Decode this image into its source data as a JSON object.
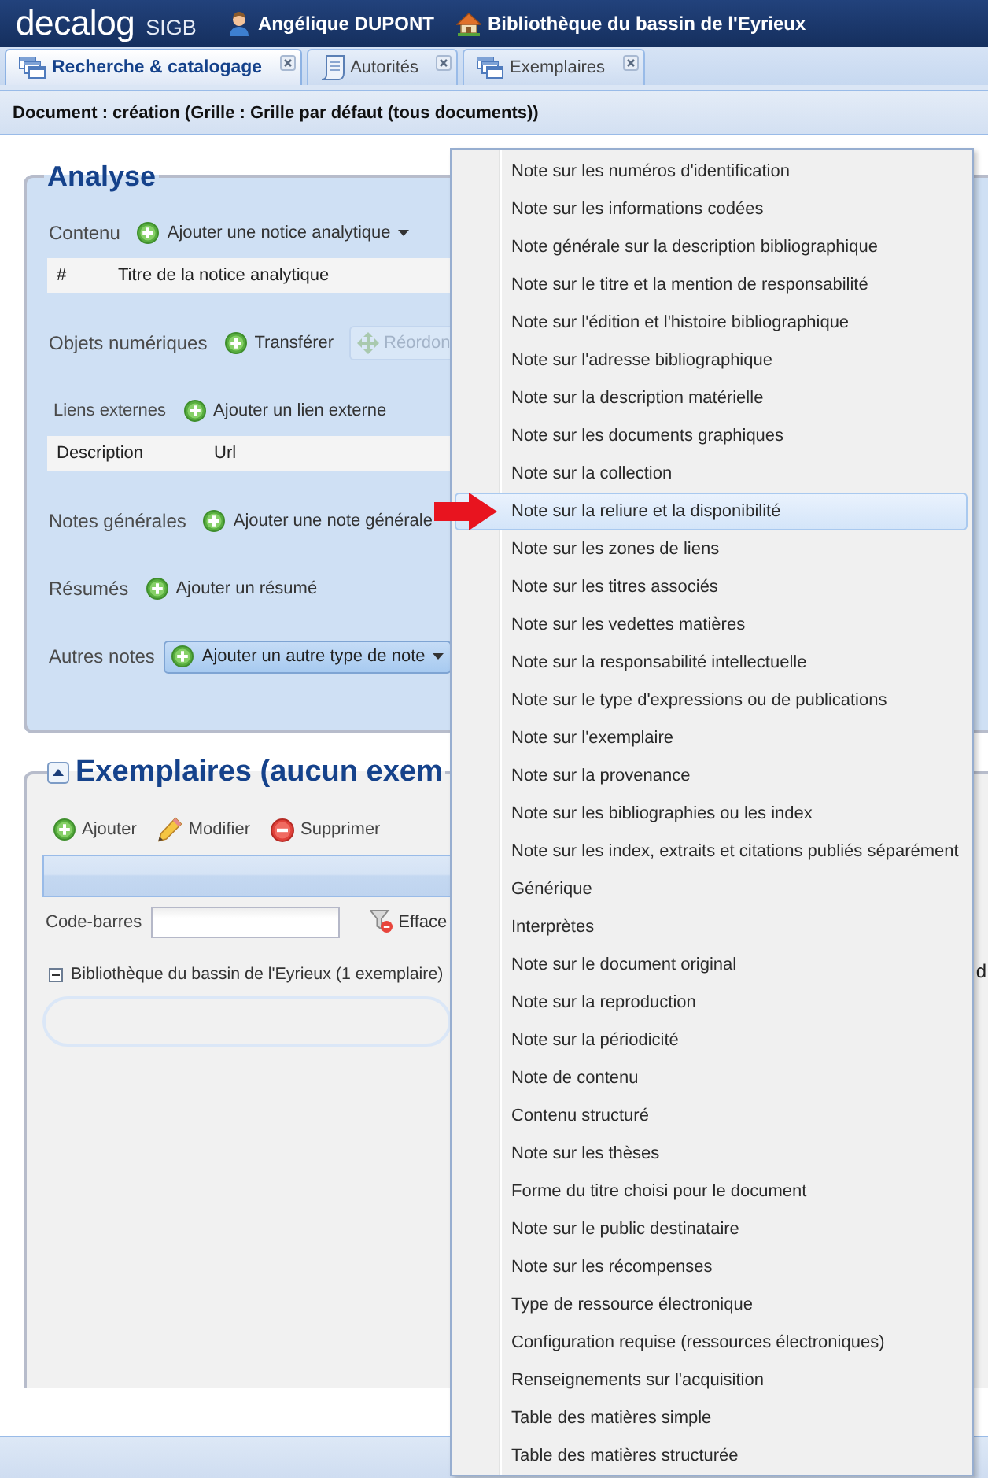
{
  "header": {
    "logo": "decalog",
    "logo_suffix": "SIGB",
    "user": "Angélique DUPONT",
    "library": "Bibliothèque du bassin de l'Eyrieux"
  },
  "tabs": [
    {
      "label": "Recherche & catalogage",
      "kind": "list",
      "selected": true
    },
    {
      "label": "Autorités",
      "kind": "document",
      "selected": false
    },
    {
      "label": "Exemplaires",
      "kind": "list",
      "selected": false
    }
  ],
  "page_title": "Document : création (Grille : Grille par défaut (tous documents))",
  "analyse": {
    "title": "Analyse",
    "sections": [
      {
        "label": "Contenu",
        "actions": [
          {
            "label": "Ajouter une notice analytique",
            "kind": "add",
            "has_menu": true,
            "disabled": false,
            "expanded": false
          }
        ],
        "columns": [
          "#",
          "Titre de la notice analytique"
        ]
      },
      {
        "label": "Objets numériques",
        "actions": [
          {
            "label": "Transférer",
            "kind": "add",
            "has_menu": false,
            "disabled": false,
            "expanded": false
          },
          {
            "label": "Réordon",
            "kind": "move",
            "has_menu": false,
            "disabled": true,
            "expanded": false
          }
        ]
      },
      {
        "label": "Liens externes",
        "actions": [
          {
            "label": "Ajouter un lien externe",
            "kind": "add",
            "has_menu": false,
            "disabled": false,
            "expanded": false
          }
        ],
        "columns": [
          "Description",
          "Url"
        ]
      },
      {
        "label": "Notes générales",
        "actions": [
          {
            "label": "Ajouter une note générale",
            "kind": "add",
            "has_menu": false,
            "disabled": false,
            "expanded": false
          }
        ]
      },
      {
        "label": "Résumés",
        "actions": [
          {
            "label": "Ajouter un résumé",
            "kind": "add",
            "has_menu": false,
            "disabled": false,
            "expanded": false
          }
        ]
      },
      {
        "label": "Autres notes",
        "actions": [
          {
            "label": "Ajouter un autre type de note",
            "kind": "add",
            "has_menu": true,
            "disabled": false,
            "expanded": true
          }
        ]
      }
    ]
  },
  "exemplaires": {
    "title": "Exemplaires (aucun exem",
    "expanded": true,
    "toolbar": [
      {
        "label": "Ajouter",
        "kind": "add"
      },
      {
        "label": "Modifier",
        "kind": "edit"
      },
      {
        "label": "Supprimer",
        "kind": "delete"
      }
    ],
    "barcode_label": "Code-barres",
    "clear_filter": "Efface",
    "group": {
      "label": "Bibliothèque du bassin de l'Eyrieux (1 exemplaire)",
      "expanded": true
    },
    "column_3": "d"
  },
  "menu": {
    "items": [
      {
        "label": "Note sur les numéros d'identification",
        "selected": false
      },
      {
        "label": "Note sur les informations codées",
        "selected": false
      },
      {
        "label": "Note générale sur la description bibliographique",
        "selected": false
      },
      {
        "label": "Note sur le titre et la mention de responsabilité",
        "selected": false
      },
      {
        "label": "Note sur l'édition et l'histoire bibliographique",
        "selected": false
      },
      {
        "label": "Note sur l'adresse bibliographique",
        "selected": false
      },
      {
        "label": "Note sur la description matérielle",
        "selected": false
      },
      {
        "label": "Note sur les documents graphiques",
        "selected": false
      },
      {
        "label": "Note sur la collection",
        "selected": false
      },
      {
        "label": "Note sur la reliure et la disponibilité",
        "selected": true
      },
      {
        "label": "Note sur les zones de liens",
        "selected": false
      },
      {
        "label": "Note sur les titres associés",
        "selected": false
      },
      {
        "label": "Note sur les vedettes matières",
        "selected": false
      },
      {
        "label": "Note sur la responsabilité intellectuelle",
        "selected": false
      },
      {
        "label": "Note sur le type d'expressions ou de publications",
        "selected": false
      },
      {
        "label": "Note sur l'exemplaire",
        "selected": false
      },
      {
        "label": "Note sur la provenance",
        "selected": false
      },
      {
        "label": "Note sur les bibliographies ou les index",
        "selected": false
      },
      {
        "label": "Note sur les index, extraits et citations publiés séparément",
        "selected": false
      },
      {
        "label": "Générique",
        "selected": false
      },
      {
        "label": "Interprètes",
        "selected": false
      },
      {
        "label": "Note sur le document original",
        "selected": false
      },
      {
        "label": "Note sur la reproduction",
        "selected": false
      },
      {
        "label": "Note sur la périodicité",
        "selected": false
      },
      {
        "label": "Note de contenu",
        "selected": false
      },
      {
        "label": "Contenu structuré",
        "selected": false
      },
      {
        "label": "Note sur les thèses",
        "selected": false
      },
      {
        "label": "Forme du titre choisi pour le document",
        "selected": false
      },
      {
        "label": "Note sur le public destinataire",
        "selected": false
      },
      {
        "label": "Note sur les récompenses",
        "selected": false
      },
      {
        "label": "Type de ressource électronique",
        "selected": false
      },
      {
        "label": "Configuration requise (ressources électroniques)",
        "selected": false
      },
      {
        "label": "Renseignements sur l'acquisition",
        "selected": false
      },
      {
        "label": "Table des matières simple",
        "selected": false
      },
      {
        "label": "Table des matières structurée",
        "selected": false
      }
    ]
  }
}
